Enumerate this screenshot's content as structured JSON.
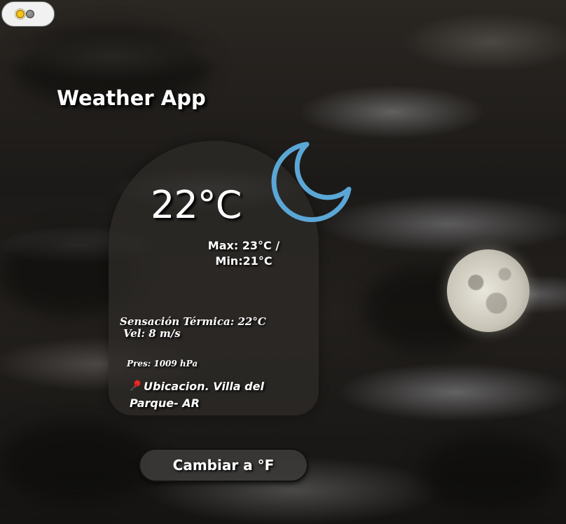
{
  "theme_toggle": {
    "left_icon": "sun-icon",
    "right_icon": "moon-icon"
  },
  "header": {
    "title": "Weather App"
  },
  "weather": {
    "condition_icon": "crescent-moon-icon",
    "icon_color": "#5aa7d6",
    "temperature": "22°C",
    "max_min_line1": "Max: 23°C /",
    "max_min_line2": "Min:21°C",
    "feels_like": "Sensación Térmica: 22°C",
    "wind": "Vel: 8 m/s",
    "pressure": "Pres: 1009 hPa",
    "location_icon": "pushpin-icon",
    "location_line1": "Ubicacion. Villa del",
    "location_line2": "Parque- AR"
  },
  "actions": {
    "convert_label": "Cambiar a °F"
  }
}
